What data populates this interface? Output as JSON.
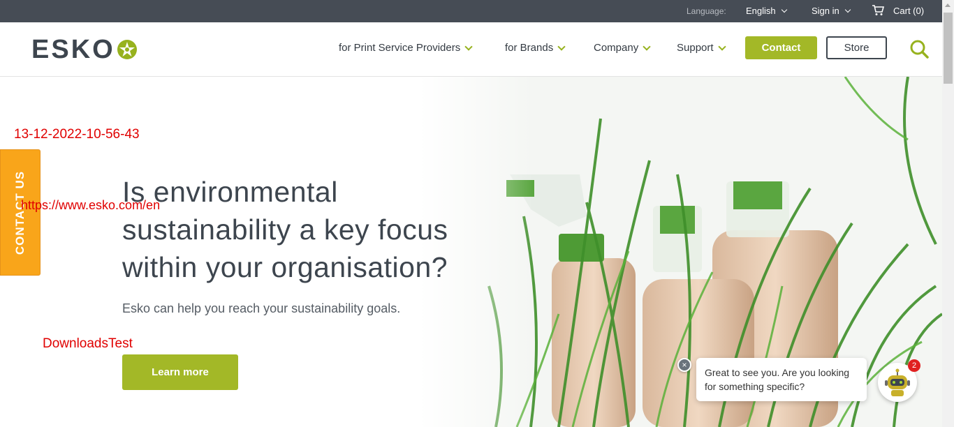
{
  "topbar": {
    "language_label": "Language:",
    "language_value": "English",
    "sign_in": "Sign in",
    "cart": "Cart (0)"
  },
  "logo": {
    "text": "ESKO"
  },
  "nav": {
    "items": [
      {
        "label": "for Print Service Providers"
      },
      {
        "label": "for Brands"
      },
      {
        "label": "Company"
      },
      {
        "label": "Support"
      }
    ],
    "contact_button": "Contact",
    "store_button": "Store"
  },
  "hero": {
    "title": "Is environmental sustainability a key focus within your organisation?",
    "subtitle": "Esko can help you reach your sustainability goals.",
    "cta": "Learn more"
  },
  "contact_tab": "CONTACT US",
  "overlays": {
    "timestamp": "13-12-2022-10-56-43",
    "url": "https://www.esko.com/en",
    "label": "DownloadsTest"
  },
  "chat": {
    "message": "Great to see you. Are you looking for something specific?",
    "badge_count": "2"
  },
  "colors": {
    "brand_green": "#a3b827",
    "topbar_bg": "#464c55",
    "contact_tab": "#f9a51a",
    "overlay_red": "#e00000"
  }
}
